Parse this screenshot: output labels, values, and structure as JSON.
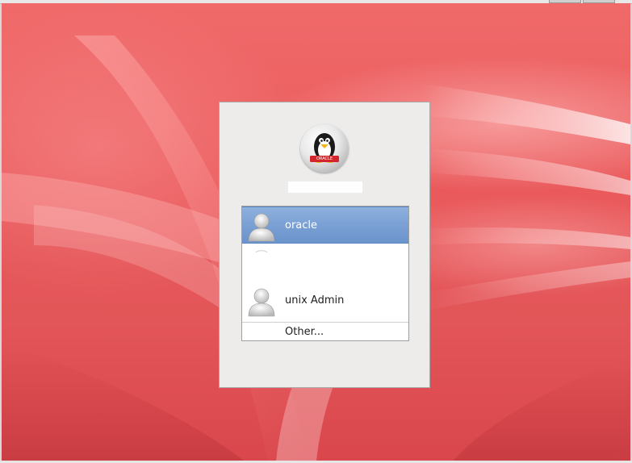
{
  "login": {
    "users": [
      {
        "name": "oracle",
        "selected": true
      },
      {
        "name": "",
        "selected": false
      },
      {
        "name": "unix Admin",
        "selected": false
      }
    ],
    "other_label": "Other...",
    "logo_text": "ORACLE"
  },
  "colors": {
    "desktop_red": "#e85a5c",
    "selection_blue": "#7aa0d4",
    "window_bg": "#edeceb"
  }
}
